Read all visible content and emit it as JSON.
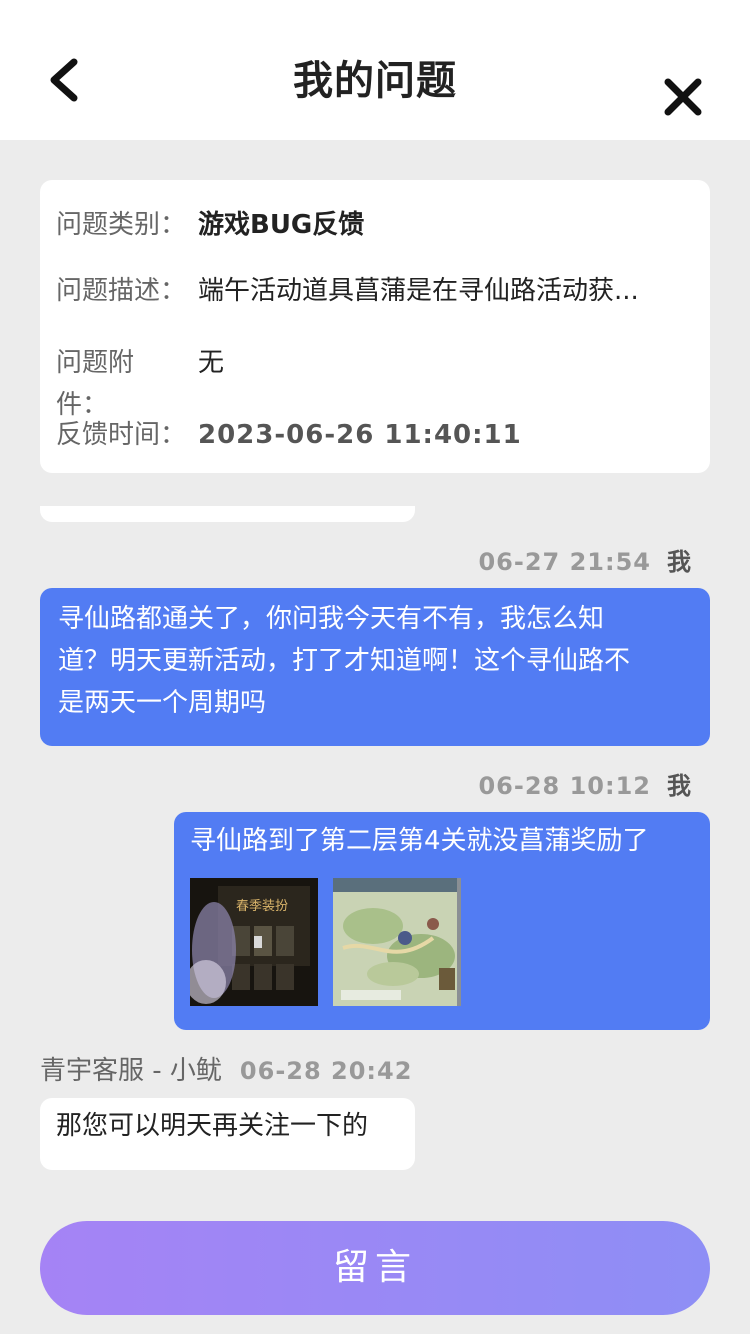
{
  "header": {
    "title": "我的问题"
  },
  "issue": {
    "category_label": "问题类别：",
    "category_value": "游戏BUG反馈",
    "desc_label": "问题描述：",
    "desc_value": "端午活动道具菖蒲是在寻仙路活动获...",
    "attach_label_1": "问题附",
    "attach_label_2": "件：",
    "attach_value": "无",
    "time_label": "反馈时间：",
    "time_value": "2023-06-26 11:40:11"
  },
  "messages": [
    {
      "time": "06-27 21:54",
      "sender": "我",
      "lines": [
        "寻仙路都通关了，你问我今天有不有，我怎么知",
        "道？明天更新活动，打了才知道啊！这个寻仙路不",
        "是两天一个周期吗"
      ]
    },
    {
      "time": "06-28 10:12",
      "sender": "我",
      "text": "寻仙路到了第二层第4关就没菖蒲奖励了",
      "images": [
        "game-screenshot-1",
        "game-screenshot-2"
      ]
    },
    {
      "sender": "青宇客服 - 小鱿",
      "time": "06-28 20:42",
      "text": "那您可以明天再关注一下的"
    }
  ],
  "actions": {
    "reply_label": "留言"
  },
  "colors": {
    "mine_bubble": "#527cf3",
    "background": "#ececec",
    "button_start": "#a583f5",
    "button_end": "#8e8ef5"
  },
  "icons": {
    "back": "chevron-left-icon",
    "close": "close-icon"
  }
}
